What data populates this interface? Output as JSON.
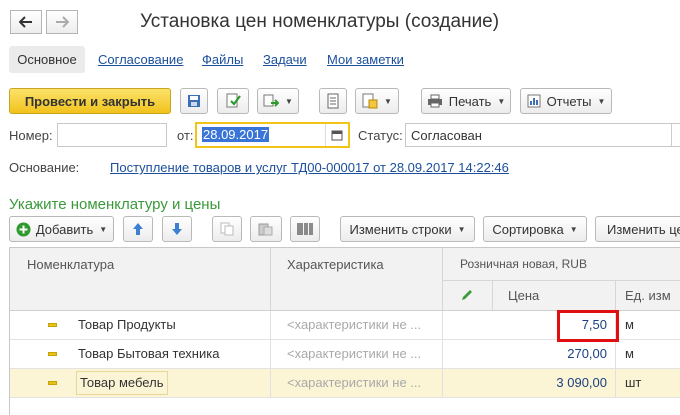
{
  "window": {
    "title": "Установка цен номенклатуры (создание)"
  },
  "nav": {
    "back_icon": "arrow-left-icon",
    "forward_icon": "arrow-right-icon"
  },
  "tabs": [
    {
      "label": "Основное",
      "active": true
    },
    {
      "label": "Согласование"
    },
    {
      "label": "Файлы"
    },
    {
      "label": "Задачи"
    },
    {
      "label": "Мои заметки"
    }
  ],
  "toolbar": {
    "post_close": "Провести и закрыть",
    "print": "Печать",
    "reports": "Отчеты",
    "icons": [
      "save-icon",
      "post-icon",
      "create-based-on-icon",
      "document-journal-icon",
      "structure-icon",
      "printer-icon",
      "report-icon"
    ]
  },
  "header": {
    "number_label": "Номер:",
    "number_value": "",
    "date_label": "от:",
    "date_value": "28.09.2017",
    "status_label": "Статус:",
    "status_value": "Согласован",
    "basis_label": "Основание:",
    "basis_link": "Поступление товаров и услуг ТД00-000017 от 28.09.2017 14:22:46"
  },
  "section": {
    "title": "Укажите номенклатуру и цены"
  },
  "table_toolbar": {
    "add": "Добавить",
    "change_rows": "Изменить строки",
    "sort": "Сортировка",
    "change_partial": "Изменить це"
  },
  "table": {
    "columns": {
      "nomenclature": "Номенклатура",
      "characteristic": "Характеристика",
      "price_group": "Розничная новая, RUB",
      "price": "Цена",
      "unit": "Ед. изм"
    },
    "rows": [
      {
        "name": "Товар Продукты",
        "characteristic": "<характеристики не ...",
        "price": "7,50",
        "unit": "м",
        "highlighted": false
      },
      {
        "name": "Товар Бытовая техника",
        "characteristic": "<характеристики не ...",
        "price": "270,00",
        "unit": "м",
        "highlighted": false
      },
      {
        "name": "Товар мебель",
        "characteristic": "<характеристики не ...",
        "price": "3 090,00",
        "unit": "шт",
        "highlighted": true
      }
    ]
  },
  "colors": {
    "accent_yellow": "#f5d33a",
    "link_blue": "#1b4f9c",
    "section_green": "#3a9a3a",
    "highlight_row": "#fbf5d6",
    "callout_red": "#e01010"
  }
}
